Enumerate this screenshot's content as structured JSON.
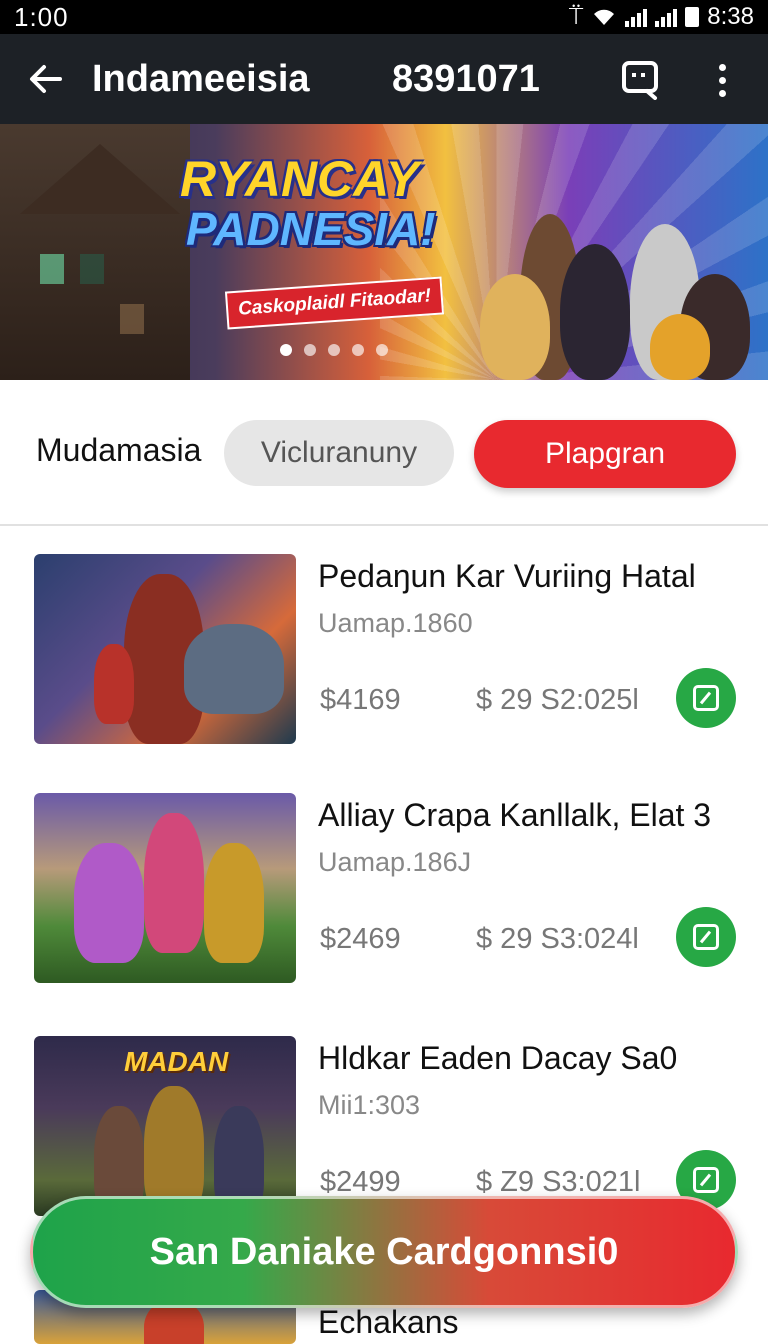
{
  "status_bar": {
    "time": "1:00",
    "right_text": "8:38"
  },
  "app_bar": {
    "title": "Indameeisia",
    "count": "8391071",
    "back_icon": "arrow-left-icon",
    "chat_icon": "chat-search-icon",
    "more_icon": "more-vert-icon"
  },
  "banner": {
    "title_line1": "RYANCAY",
    "title_line2": "PADNESIA!",
    "tagline": "Caskoplaidl Fitaodar!",
    "page_dots": 5,
    "active_dot": 1
  },
  "filter": {
    "label": "Mudamasia",
    "chip_secondary": "Vicluranuny",
    "chip_primary": "Plapgran"
  },
  "items": [
    {
      "title": "Pedaŋun Kar Vuriing Hatal",
      "subtitle": "Uamap.1860",
      "price": "$4169",
      "meta": "$ 29  S2:025l"
    },
    {
      "title": "Alliay Crapa Kanllalk, Elat 3",
      "subtitle": "Uamap.186J",
      "price": "$2469",
      "meta": "$ 29  S3:024l"
    },
    {
      "title": "Hldkar Eaden Dacay Sa0",
      "subtitle": "Mii1:303",
      "price": "$2499",
      "meta": "$ Z9  S3:021l",
      "thumb_caption": "MADAN"
    },
    {
      "title": "Echakans"
    }
  ],
  "cta": {
    "label": "San Daniake Cardgonnsi0"
  },
  "colors": {
    "app_bar": "#1d2126",
    "accent_red": "#e8292f",
    "accent_green": "#27a845"
  }
}
